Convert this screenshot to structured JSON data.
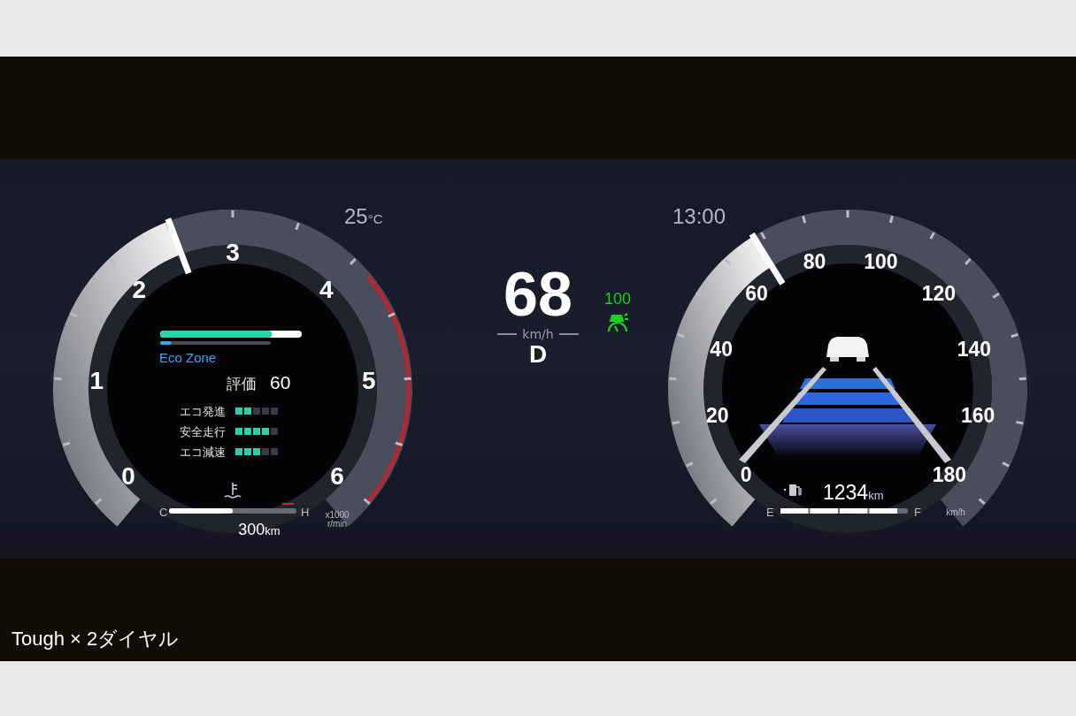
{
  "outside_temp": {
    "value": "25",
    "unit": "°C"
  },
  "clock": "13:00",
  "tachometer": {
    "labels": [
      "0",
      "1",
      "2",
      "3",
      "4",
      "5",
      "6"
    ],
    "unit_lines": [
      "x1000",
      "r/min"
    ]
  },
  "eco_bar": {
    "level": 0.79
  },
  "eco_zone_bar": {
    "label": "Eco Zone",
    "level": 0.1
  },
  "score": {
    "label": "評価",
    "value": "60"
  },
  "ratings": [
    {
      "label": "エコ発進",
      "level": 0.4
    },
    {
      "label": "安全走行",
      "level": 0.8
    },
    {
      "label": "エコ減速",
      "level": 0.6
    }
  ],
  "coolant": {
    "cold_label": "C",
    "hot_label": "H",
    "level": 0.5
  },
  "range": {
    "value": "300",
    "unit": "km"
  },
  "speed": {
    "value": "68",
    "unit": "km/h"
  },
  "gear": "D",
  "cruise": {
    "set_speed": "100",
    "active": true
  },
  "speedometer": {
    "labels": [
      "0",
      "20",
      "40",
      "60",
      "80",
      "100",
      "120",
      "140",
      "160",
      "180"
    ],
    "unit": "km/h"
  },
  "fuel": {
    "empty_label": "E",
    "full_label": "F",
    "level": 0.93,
    "range": "1234",
    "unit": "km"
  },
  "caption": "Tough × 2ダイヤル"
}
